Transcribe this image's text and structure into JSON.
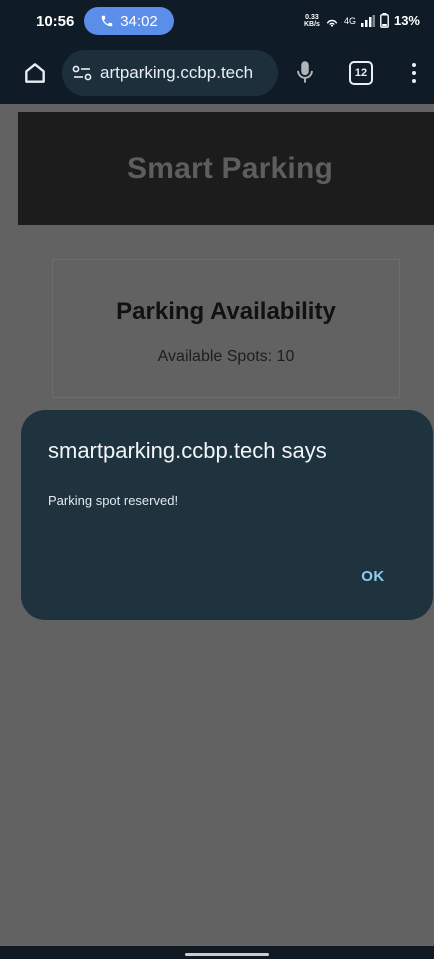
{
  "status_bar": {
    "time": "10:56",
    "call_duration": "34:02",
    "net_speed_top": "0.33",
    "net_speed_bottom": "KB/s",
    "network": "4G",
    "battery": "13%",
    "icons": [
      "phone-icon",
      "hotspot-icon",
      "signal-icon",
      "battery-icon"
    ]
  },
  "browser": {
    "url": "artparking.ccbp.tech",
    "tab_count": "12",
    "icons": [
      "home-icon",
      "site-settings-icon",
      "mic-icon",
      "tabs-icon",
      "more-vert-icon"
    ]
  },
  "page": {
    "header_title": "Smart Parking",
    "card_title": "Parking Availability",
    "available_spots": "Available Spots: 10"
  },
  "dialog": {
    "title": "smartparking.ccbp.tech says",
    "message": "Parking spot reserved!",
    "ok_label": "OK"
  },
  "colors": {
    "chrome_bg": "#0f1b26",
    "call_chip": "#5b8ee8",
    "dialog_bg": "#1f333f",
    "dialog_button": "#8ccdf0",
    "page_dim": "#626262"
  }
}
